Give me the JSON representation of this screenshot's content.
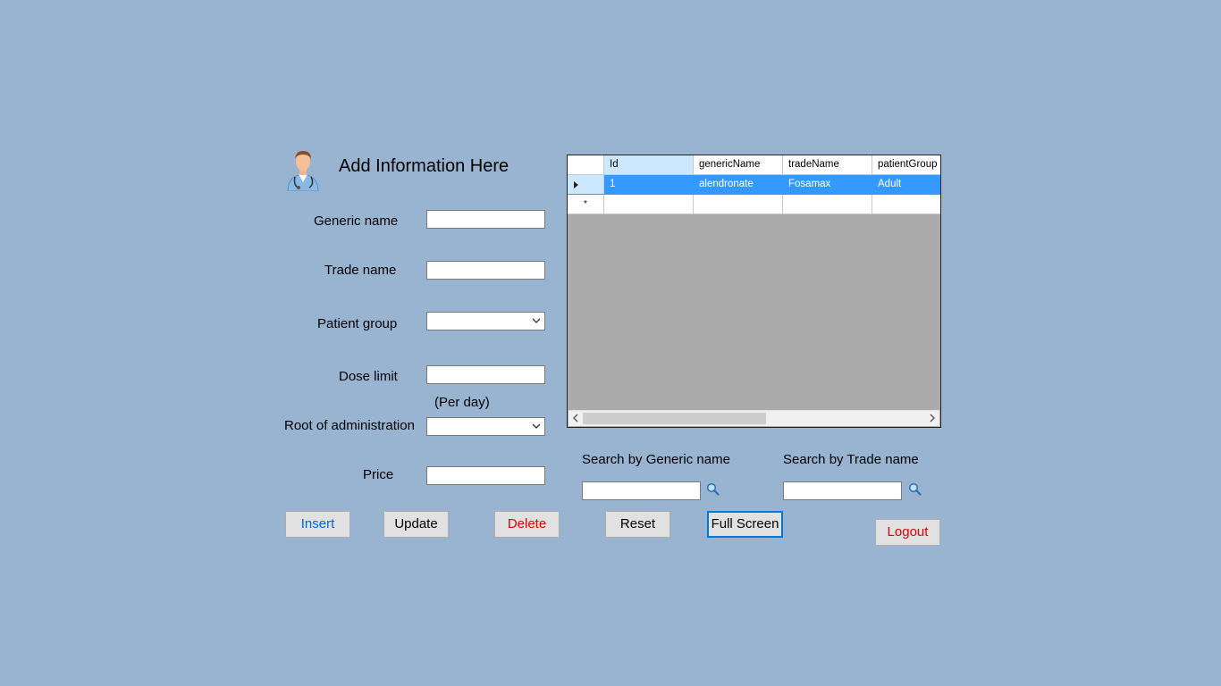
{
  "header": {
    "title": "Add Information Here",
    "avatar_icon": "doctor-icon"
  },
  "form": {
    "generic_name": {
      "label": "Generic name",
      "value": ""
    },
    "trade_name": {
      "label": "Trade name",
      "value": ""
    },
    "patient_group": {
      "label": "Patient group",
      "selected": ""
    },
    "dose_limit": {
      "label": "Dose limit",
      "value": "",
      "note": "(Per day)"
    },
    "route": {
      "label": "Root of administration",
      "selected": ""
    },
    "price": {
      "label": "Price",
      "value": ""
    }
  },
  "grid": {
    "columns": [
      "Id",
      "genericName",
      "tradeName",
      "patientGroup"
    ],
    "rows": [
      {
        "id": "1",
        "genericName": "alendronate",
        "tradeName": "Fosamax",
        "patientGroup": "Adult",
        "selected": true
      }
    ],
    "new_row_marker": "*"
  },
  "search": {
    "generic_label": "Search by Generic name",
    "generic_value": "",
    "trade_label": "Search by Trade name",
    "trade_value": "",
    "icon": "search-icon"
  },
  "buttons": {
    "insert": "Insert",
    "update": "Update",
    "delete": "Delete",
    "reset": "Reset",
    "fullscreen": "Full Screen",
    "logout": "Logout"
  },
  "colors": {
    "background": "#99b4d1",
    "insert_text": "#0066cc",
    "delete_text": "#e00000",
    "logout_text": "#e00000",
    "selection": "#3399ff"
  }
}
